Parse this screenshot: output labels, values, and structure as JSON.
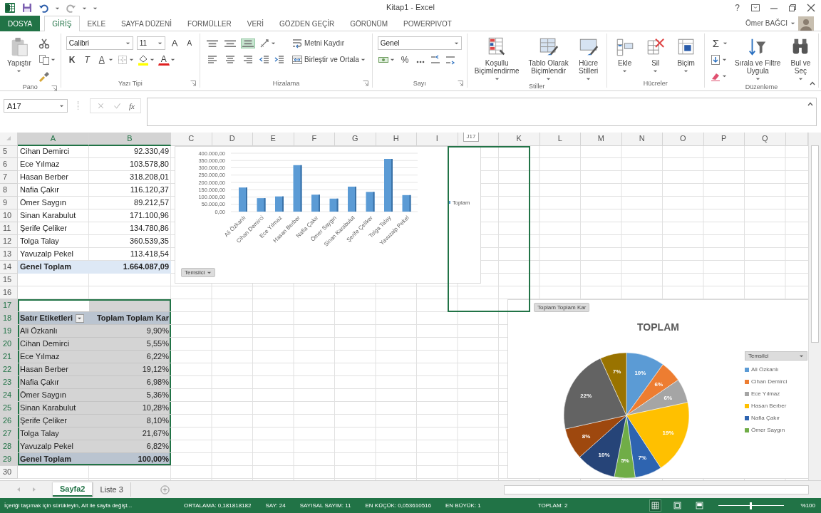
{
  "window": {
    "title": "Kitap1 - Excel",
    "help_button": "?"
  },
  "ribbon_tabs": [
    {
      "label": "DOSYA",
      "kind": "file",
      "selected": false
    },
    {
      "label": "GİRİŞ",
      "kind": "tab",
      "selected": true
    },
    {
      "label": "EKLE",
      "kind": "tab",
      "selected": false
    },
    {
      "label": "SAYFA DÜZENİ",
      "kind": "tab",
      "selected": false
    },
    {
      "label": "FORMÜLLER",
      "kind": "tab",
      "selected": false
    },
    {
      "label": "VERİ",
      "kind": "tab",
      "selected": false
    },
    {
      "label": "GÖZDEN GEÇİR",
      "kind": "tab",
      "selected": false
    },
    {
      "label": "GÖRÜNÜM",
      "kind": "tab",
      "selected": false
    },
    {
      "label": "POWERPIVOT",
      "kind": "tab",
      "selected": false
    }
  ],
  "user": {
    "name": "Ömer BAĞCI"
  },
  "ribbon_groups": [
    {
      "label": "Pano",
      "launcher": true,
      "parts": [
        {
          "kind": "paste",
          "label": "Yapıştır",
          "dropdown": true
        },
        {
          "kind": "stack",
          "lines": [
            {
              "items": [
                {
                  "kind": "cut"
                }
              ]
            },
            {
              "items": [
                {
                  "kind": "copy",
                  "dropdown": true
                }
              ]
            },
            {
              "items": [
                {
                  "kind": "brush"
                }
              ]
            }
          ]
        }
      ]
    },
    {
      "label": "Yazı Tipi",
      "launcher": true,
      "parts": [
        {
          "kind": "stack",
          "lines": [
            {
              "items": [
                {
                  "kind": "font-name",
                  "value": "Calibri"
                },
                {
                  "kind": "font-size",
                  "value": "11"
                },
                {
                  "kind": "grow",
                  "text": "A"
                },
                {
                  "kind": "shrink",
                  "text": "A"
                }
              ]
            },
            {
              "items": [
                {
                  "kind": "bold",
                  "text": "K"
                },
                {
                  "kind": "italic",
                  "text": "T"
                },
                {
                  "kind": "underline",
                  "text": "A",
                  "dropdown": true
                },
                {
                  "kind": "border",
                  "dropdown": true
                },
                {
                  "kind": "fill",
                  "dropdown": true
                },
                {
                  "kind": "font-color",
                  "text": "A",
                  "dropdown": true
                }
              ]
            }
          ]
        }
      ]
    },
    {
      "label": "Hizalama",
      "launcher": true,
      "parts": [
        {
          "kind": "stack",
          "lines": [
            {
              "items": [
                {
                  "kind": "align-top",
                  "on": false
                },
                {
                  "kind": "align-middle",
                  "on": false
                },
                {
                  "kind": "align-bottom",
                  "on": true
                },
                {
                  "kind": "orientation",
                  "dropdown": true
                }
              ]
            },
            {
              "items": [
                {
                  "kind": "align-left",
                  "on": false
                },
                {
                  "kind": "align-center",
                  "on": false
                },
                {
                  "kind": "align-right",
                  "on": false
                },
                {
                  "kind": "outdent"
                },
                {
                  "kind": "indent"
                }
              ]
            }
          ]
        },
        {
          "kind": "stack",
          "lines": [
            {
              "items": [
                {
                  "kind": "wrap",
                  "label": "Metni Kaydır"
                }
              ]
            },
            {
              "items": [
                {
                  "kind": "merge",
                  "label": "Birleştir ve Ortala",
                  "dropdown": true
                }
              ]
            }
          ]
        }
      ]
    },
    {
      "label": "Sayı",
      "launcher": true,
      "parts": [
        {
          "kind": "stack",
          "lines": [
            {
              "items": [
                {
                  "kind": "number-format",
                  "value": "Genel"
                }
              ]
            },
            {
              "items": [
                {
                  "kind": "currency",
                  "dropdown": true
                },
                {
                  "kind": "percent",
                  "text": "%"
                },
                {
                  "kind": "comma"
                },
                {
                  "kind": "dec-inc"
                },
                {
                  "kind": "dec-dec"
                }
              ]
            }
          ]
        }
      ]
    },
    {
      "label": "Stiller",
      "parts": [
        {
          "kind": "conditional",
          "label": "Koşullu\nBiçimlendirme",
          "dropdown": true
        },
        {
          "kind": "table-format",
          "label": "Tablo Olarak\nBiçimlendir",
          "dropdown": true
        },
        {
          "kind": "cell-styles",
          "label": "Hücre\nStilleri",
          "dropdown": true
        }
      ]
    },
    {
      "label": "Hücreler",
      "parts": [
        {
          "kind": "insert-cells",
          "label": "Ekle",
          "dropdown": true
        },
        {
          "kind": "delete-cells",
          "label": "Sil",
          "dropdown": true
        },
        {
          "kind": "format-cells",
          "label": "Biçim",
          "dropdown": true
        }
      ]
    },
    {
      "label": "Düzenleme",
      "parts": [
        {
          "kind": "stack",
          "lines": [
            {
              "items": [
                {
                  "kind": "autosum",
                  "text": "Σ",
                  "dropdown": true
                }
              ]
            },
            {
              "items": [
                {
                  "kind": "fill-down",
                  "dropdown": true
                }
              ]
            },
            {
              "items": [
                {
                  "kind": "clear",
                  "dropdown": true
                }
              ]
            }
          ]
        },
        {
          "kind": "sort-filter",
          "label": "Sırala ve Filtre\nUygula",
          "dropdown": true
        },
        {
          "kind": "find",
          "label": "Bul ve\nSeç",
          "dropdown": true
        }
      ]
    }
  ],
  "formula_bar": {
    "name_box": "A17",
    "function_button": "fx"
  },
  "sheet": {
    "columns": [
      {
        "label": "A",
        "selected": true
      },
      {
        "label": "B",
        "selected": true
      },
      {
        "label": "C",
        "selected": false
      },
      {
        "label": "D",
        "selected": false
      },
      {
        "label": "E",
        "selected": false
      },
      {
        "label": "F",
        "selected": false
      },
      {
        "label": "G",
        "selected": false
      },
      {
        "label": "H",
        "selected": false
      },
      {
        "label": "I",
        "selected": false
      },
      {
        "tooltip": "J17",
        "selected": false
      },
      {
        "label": "K",
        "selected": false
      },
      {
        "label": "L",
        "selected": false
      },
      {
        "label": "M",
        "selected": false
      },
      {
        "label": "N",
        "selected": false
      },
      {
        "label": "O",
        "selected": false
      },
      {
        "label": "P",
        "selected": false
      },
      {
        "label": "Q",
        "selected": false
      }
    ],
    "rows": [
      {
        "number": "5",
        "selected": false,
        "kind": "data",
        "cells": [
          "Cihan Demirci",
          "92.330,49"
        ]
      },
      {
        "number": "6",
        "selected": false,
        "kind": "data",
        "cells": [
          "Ece Yılmaz",
          "103.578,80"
        ]
      },
      {
        "number": "7",
        "selected": false,
        "kind": "data",
        "cells": [
          "Hasan Berber",
          "318.208,01"
        ]
      },
      {
        "number": "8",
        "selected": false,
        "kind": "data",
        "cells": [
          "Nafia Çakır",
          "116.120,37"
        ]
      },
      {
        "number": "9",
        "selected": false,
        "kind": "data",
        "cells": [
          "Ömer Saygın",
          "89.212,57"
        ]
      },
      {
        "number": "10",
        "selected": false,
        "kind": "data",
        "cells": [
          "Sinan Karabulut",
          "171.100,96"
        ]
      },
      {
        "number": "11",
        "selected": false,
        "kind": "data",
        "cells": [
          "Şerife Çeliker",
          "134.780,86"
        ]
      },
      {
        "number": "12",
        "selected": false,
        "kind": "data",
        "cells": [
          "Tolga Talay",
          "360.539,35"
        ]
      },
      {
        "number": "13",
        "selected": false,
        "kind": "data",
        "cells": [
          "Yavuzalp Pekel",
          "113.418,54"
        ]
      },
      {
        "number": "14",
        "selected": false,
        "kind": "total",
        "cells": [
          "Genel Toplam",
          "1.664.087,09"
        ]
      },
      {
        "number": "15",
        "selected": false,
        "kind": "blank"
      },
      {
        "number": "16",
        "selected": false,
        "kind": "blank"
      },
      {
        "number": "17",
        "selected": true,
        "kind": "blank"
      },
      {
        "number": "18",
        "selected": true,
        "kind": "header",
        "cells": [
          "Satır Etiketleri",
          "Toplam Toplam Kar"
        ]
      },
      {
        "number": "19",
        "selected": true,
        "kind": "data",
        "cells": [
          "Ali Özkanlı",
          "9,90%"
        ]
      },
      {
        "number": "20",
        "selected": true,
        "kind": "data",
        "cells": [
          "Cihan Demirci",
          "5,55%"
        ]
      },
      {
        "number": "21",
        "selected": true,
        "kind": "data",
        "cells": [
          "Ece Yılmaz",
          "6,22%"
        ]
      },
      {
        "number": "22",
        "selected": true,
        "kind": "data",
        "cells": [
          "Hasan Berber",
          "19,12%"
        ]
      },
      {
        "number": "23",
        "selected": true,
        "kind": "data",
        "cells": [
          "Nafia Çakır",
          "6,98%"
        ]
      },
      {
        "number": "24",
        "selected": true,
        "kind": "data",
        "cells": [
          "Ömer Saygın",
          "5,36%"
        ]
      },
      {
        "number": "25",
        "selected": true,
        "kind": "data",
        "cells": [
          "Sinan Karabulut",
          "10,28%"
        ]
      },
      {
        "number": "26",
        "selected": true,
        "kind": "data",
        "cells": [
          "Şerife Çeliker",
          "8,10%"
        ]
      },
      {
        "number": "27",
        "selected": true,
        "kind": "data",
        "cells": [
          "Tolga Talay",
          "21,67%"
        ]
      },
      {
        "number": "28",
        "selected": true,
        "kind": "data",
        "cells": [
          "Yavuzalp Pekel",
          "6,82%"
        ]
      },
      {
        "number": "29",
        "selected": true,
        "kind": "total",
        "cells": [
          "Genel Toplam",
          "100,00%"
        ]
      },
      {
        "number": "30",
        "selected": false,
        "kind": "blank"
      }
    ],
    "bar_chart": {
      "field_button": "Temsilci",
      "chart_data": {
        "type": "bar",
        "categories": [
          "Ali Özkanlı",
          "Cihan Demirci",
          "Ece Yılmaz",
          "Hasan Berber",
          "Nafia Çakır",
          "Ömer Saygın",
          "Sinan Karabulut",
          "Şerife Çeliker",
          "Tolga Talay",
          "Yavuzalp Pekel"
        ],
        "series": [
          {
            "name": "Toplam",
            "color": "#5b9bd5",
            "values": [
              165000,
              92000,
              104000,
              318000,
              116000,
              89000,
              171000,
              135000,
              361000,
              113000
            ]
          }
        ],
        "ylim": [
          0,
          400000
        ],
        "grid": true,
        "legend": "right",
        "yticks": [
          {
            "value": 0,
            "label": "0,00"
          },
          {
            "value": 50000,
            "label": "50.000,00"
          },
          {
            "value": 100000,
            "label": "100.000,00"
          },
          {
            "value": 150000,
            "label": "150.000,00"
          },
          {
            "value": 200000,
            "label": "200.000,00"
          },
          {
            "value": 250000,
            "label": "250.000,00"
          },
          {
            "value": 300000,
            "label": "300.000,00"
          },
          {
            "value": 350000,
            "label": "350.000,00"
          },
          {
            "value": 400000,
            "label": "400.000,00"
          }
        ]
      }
    },
    "pie_chart": {
      "field_button": "Toplam Toplam Kar",
      "legend_field": "Temsilci",
      "slices": [
        {
          "color": "#5b9bd5"
        },
        {
          "color": "#ed7d31"
        },
        {
          "color": "#a5a5a5"
        },
        {
          "color": "#ffc000"
        },
        {
          "color": "#2e64b0"
        },
        {
          "color": "#70ad47"
        },
        {
          "color": "#264478"
        },
        {
          "color": "#9e480e"
        },
        {
          "color": "#636363"
        },
        {
          "color": "#997300"
        }
      ],
      "legend_items": [
        {
          "label": "Ali Özkanlı",
          "color": "#5b9bd5"
        },
        {
          "label": "Cihan Demirci",
          "color": "#ed7d31"
        },
        {
          "label": "Ece Yılmaz",
          "color": "#a5a5a5"
        },
        {
          "label": "Hasan Berber",
          "color": "#ffc000"
        },
        {
          "label": "Nafia Çakır",
          "color": "#2e64b0"
        },
        {
          "label": "Ömer Saygın",
          "color": "#70ad47"
        }
      ],
      "chart_data": {
        "type": "pie",
        "title": "TOPLAM",
        "series": [
          {
            "values": [
              9.9,
              5.55,
              6.22,
              19.12,
              6.98,
              5.36,
              10.28,
              8.1,
              21.67,
              6.82
            ]
          }
        ],
        "value_labels": [
          "10%",
          "6%",
          "6%",
          "19%",
          "7%",
          "5%",
          "10%",
          "8%",
          "22%",
          "7%"
        ]
      }
    }
  },
  "sheet_tabs": [
    {
      "label": "Sayfa2",
      "selected": true
    },
    {
      "label": "Liste 3",
      "selected": false
    }
  ],
  "status_bar": {
    "message": "İçeriği taşımak için sürükleyin, Alt ile sayfa değişt...",
    "stats": [
      "ORTALAMA: 0,181818182",
      "SAY: 24",
      "SAYISAL SAYIM: 11",
      "EN KÜÇÜK: 0,053610516",
      "EN BÜYÜK: 1",
      "TOPLAM: 2"
    ],
    "views": [
      {
        "kind": "normal",
        "selected": true
      },
      {
        "kind": "page-layout",
        "selected": false
      },
      {
        "kind": "page-break",
        "selected": false
      }
    ],
    "zoom": {
      "level": 0.5,
      "label": "%100"
    }
  }
}
